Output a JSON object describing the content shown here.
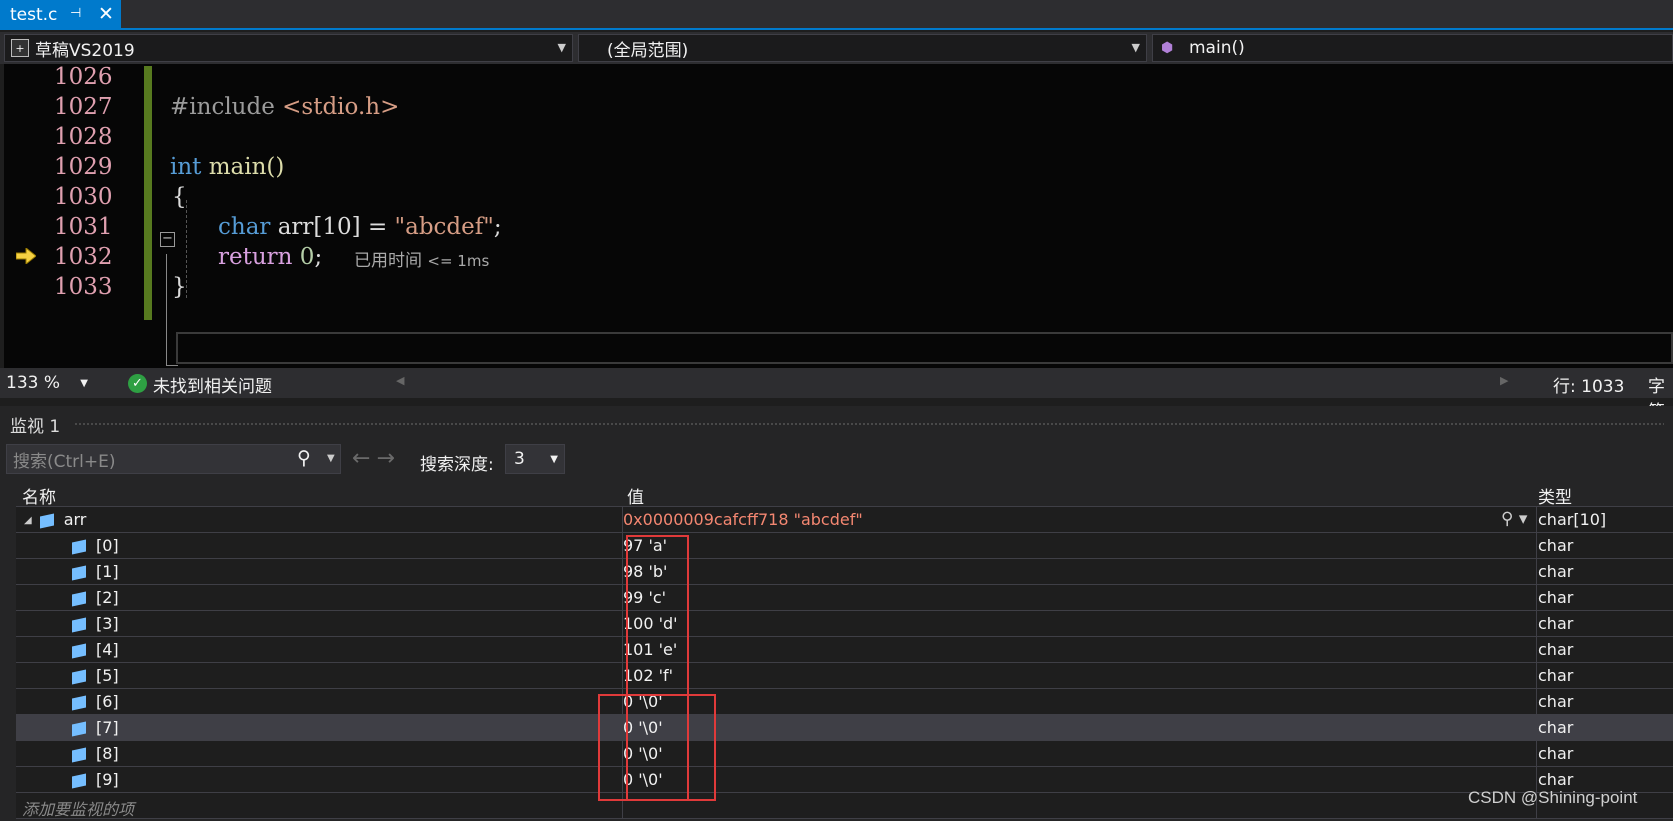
{
  "tab": {
    "label": "test.c",
    "pin": "⊣",
    "close": "✕"
  },
  "navbar": {
    "project": "草稿VS2019",
    "scope": "(全局范围)",
    "member": "main()"
  },
  "editor": {
    "lines": [
      {
        "num": "1026"
      },
      {
        "num": "1027"
      },
      {
        "num": "1028"
      },
      {
        "num": "1029"
      },
      {
        "num": "1030"
      },
      {
        "num": "1031"
      },
      {
        "num": "1032"
      },
      {
        "num": "1033"
      }
    ],
    "code": {
      "include_kw": "#include",
      "include_file": "<stdio.h>",
      "int_kw": "int",
      "main_fn": " main()",
      "open_brace": "{",
      "char_kw": "char",
      "arr_decl": " arr[10] = ",
      "arr_str": "\"abcdef\"",
      "semi": ";",
      "return_kw": "return",
      "zero": " 0",
      "return_semi": ";",
      "close_brace": "}"
    },
    "elapsed": "已用时间",
    "elapsed_value": "<= 1ms"
  },
  "status": {
    "zoom": "133 %",
    "issues": "未找到相关问题",
    "line": "行: 1033",
    "char": "字符"
  },
  "watch": {
    "title": "监视 1",
    "search_placeholder": "搜索(Ctrl+E)",
    "depth_label": "搜索深度:",
    "depth_value": "3",
    "columns": {
      "name": "名称",
      "value": "值",
      "type": "类型"
    },
    "root": {
      "name": "arr",
      "value": "0x0000009cafcff718 \"abcdef\"",
      "type": "char[10]"
    },
    "items": [
      {
        "name": "[0]",
        "value": "97 'a'",
        "type": "char"
      },
      {
        "name": "[1]",
        "value": "98 'b'",
        "type": "char"
      },
      {
        "name": "[2]",
        "value": "99 'c'",
        "type": "char"
      },
      {
        "name": "[3]",
        "value": "100 'd'",
        "type": "char"
      },
      {
        "name": "[4]",
        "value": "101 'e'",
        "type": "char"
      },
      {
        "name": "[5]",
        "value": "102 'f'",
        "type": "char"
      },
      {
        "name": "[6]",
        "value": "0 '\\0'",
        "type": "char"
      },
      {
        "name": "[7]",
        "value": "0 '\\0'",
        "type": "char"
      },
      {
        "name": "[8]",
        "value": "0 '\\0'",
        "type": "char"
      },
      {
        "name": "[9]",
        "value": "0 '\\0'",
        "type": "char"
      }
    ],
    "add_item": "添加要监视的项"
  },
  "watermark": "CSDN @Shining-point",
  "colors": {
    "accent": "#007acc",
    "highlight": "#e03a3a",
    "changed_value": "#f48771"
  }
}
